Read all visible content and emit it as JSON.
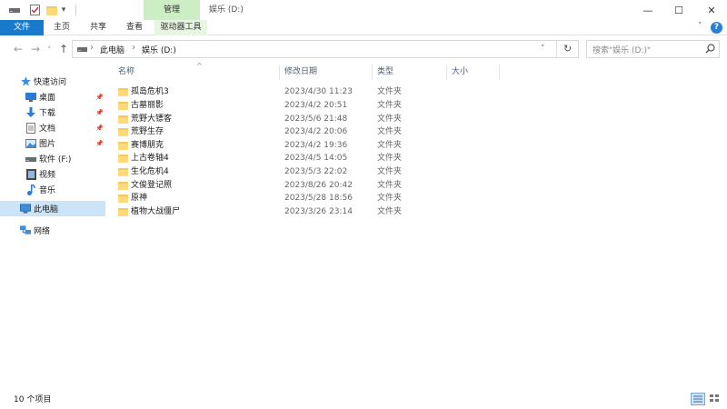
{
  "titlebar": {
    "manage_tab": "管理",
    "window_title": "娱乐 (D:)",
    "icons": [
      "drive-icon",
      "properties-check-icon",
      "new-folder-icon",
      "customize-dropdown-icon"
    ]
  },
  "window_controls": {
    "minimize": "—",
    "maximize": "☐",
    "close": "✕"
  },
  "ribbon": {
    "tabs": [
      "文件",
      "主页",
      "共享",
      "查看",
      "驱动器工具"
    ],
    "collapse": "˅",
    "help": "?"
  },
  "nav": {
    "back": "←",
    "forward": "→",
    "recent": "˅",
    "up": "↑",
    "refresh": "↻",
    "dropdown": "˅"
  },
  "address": {
    "crumbs": [
      "此电脑",
      "娱乐 (D:)"
    ],
    "separator": "›"
  },
  "search": {
    "placeholder": "搜索\"娱乐 (D:)\""
  },
  "sidebar": {
    "items": [
      {
        "label": "快速访问",
        "icon": "star-icon"
      },
      {
        "label": "桌面",
        "icon": "desktop-icon"
      },
      {
        "label": "下载",
        "icon": "download-icon"
      },
      {
        "label": "文档",
        "icon": "documents-icon"
      },
      {
        "label": "图片",
        "icon": "pictures-icon"
      },
      {
        "label": "软件 (F:)",
        "icon": "drive-icon"
      },
      {
        "label": "视频",
        "icon": "video-icon"
      },
      {
        "label": "音乐",
        "icon": "music-icon"
      },
      {
        "label": "此电脑",
        "icon": "computer-icon"
      },
      {
        "label": "网络",
        "icon": "network-icon"
      }
    ]
  },
  "columns": {
    "name": "名称",
    "date": "修改日期",
    "type": "类型",
    "size": "大小",
    "sort_indicator": "^"
  },
  "files": [
    {
      "name": "孤岛危机3",
      "date": "2023/4/30 11:23",
      "type": "文件夹"
    },
    {
      "name": "古墓丽影",
      "date": "2023/4/2 20:51",
      "type": "文件夹"
    },
    {
      "name": "荒野大镖客",
      "date": "2023/5/6 21:48",
      "type": "文件夹"
    },
    {
      "name": "荒野生存",
      "date": "2023/4/2 20:06",
      "type": "文件夹"
    },
    {
      "name": "赛博朋克",
      "date": "2023/4/2 19:36",
      "type": "文件夹"
    },
    {
      "name": "上古卷轴4",
      "date": "2023/4/5 14:05",
      "type": "文件夹"
    },
    {
      "name": "生化危机4",
      "date": "2023/5/3 22:02",
      "type": "文件夹"
    },
    {
      "name": "文俊登记照",
      "date": "2023/8/26 20:42",
      "type": "文件夹"
    },
    {
      "name": "原神",
      "date": "2023/5/28 18:56",
      "type": "文件夹"
    },
    {
      "name": "植物大战僵尸",
      "date": "2023/3/26 23:14",
      "type": "文件夹"
    }
  ],
  "status": {
    "count": "10 个项目"
  },
  "colors": {
    "accent": "#1979ca",
    "manage_tab": "#cdeec5",
    "selection": "#cce4f7",
    "folder": "#ffd97a"
  }
}
